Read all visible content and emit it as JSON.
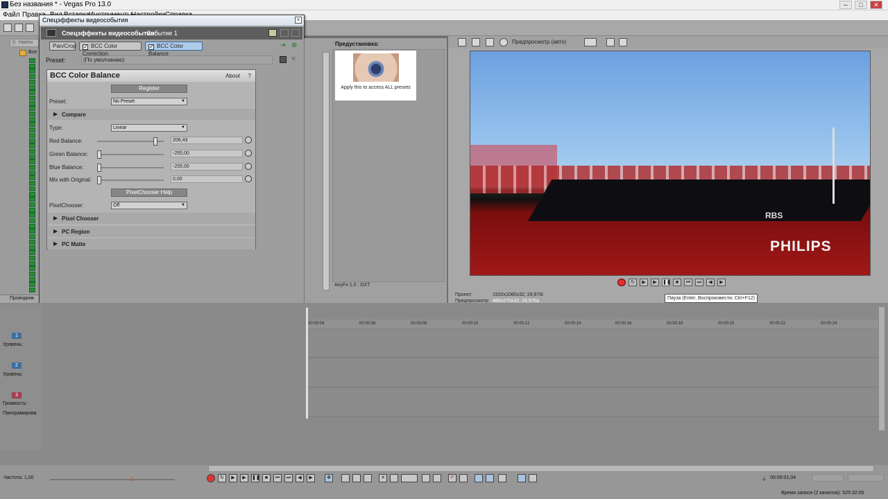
{
  "window": {
    "title": "Без названия * - Vegas Pro 13.0",
    "min": "─",
    "max": "□",
    "close": "✕"
  },
  "menu": [
    "Файл",
    "Правка",
    "Вид",
    "Вставка",
    "Инструменты",
    "Настройки",
    "Справка"
  ],
  "explorer": {
    "search_placeholder": "Найти",
    "item": "Все",
    "tab": "Проводник"
  },
  "fx": {
    "window_title": "Спецэффекты видеособытия",
    "close": "×",
    "header_title": "Спецэффекты видеособытия:",
    "header_event": "Событие 1",
    "chain": [
      "Pan/Crop",
      "BCC Color Correction",
      "BCC Color Balance"
    ],
    "preset_label": "Preset:",
    "preset_value": "(По умолчанию)",
    "plugin": {
      "title": "BCC Color Balance",
      "about": "About",
      "help": "?",
      "register": "Register",
      "preset_label": "Preset:",
      "preset_value": "No Preset",
      "compare": "Compare",
      "type_label": "Type:",
      "type_value": "Linear",
      "params": [
        {
          "label": "Red Balance:",
          "value": "206,43",
          "level": 0.9
        },
        {
          "label": "Green Balance:",
          "value": "-255,00",
          "level": 0.0
        },
        {
          "label": "Blue Balance:",
          "value": "-255,00",
          "level": 0.0
        },
        {
          "label": "Mix with Original:",
          "value": "0,00",
          "level": 0.0
        }
      ],
      "pixelchooser_help": "PixelChooser Help",
      "pixelchooser_label": "PixelChooser:",
      "pixelchooser_value": "Off",
      "sections": [
        "Pixel Chooser",
        "PC Region",
        "PC Matte"
      ]
    }
  },
  "preset_browser": {
    "title": "Предустановка:",
    "card_caption": "Apply this to access ALL presets",
    "footer": "AnyFx 1.0 : DXT"
  },
  "preview": {
    "mode": "Предпросмотр (авто)",
    "watermark": "PHILIPS",
    "sign": "RBS",
    "project_label": "Проект:",
    "project_value": "1920x1080x32; 29,970i",
    "preview_label": "Предпросмотр:",
    "preview_value": "480x270x32; 29,970p",
    "tooltip": "Пауза (Enter, Воспроизвести; Ctrl+F12)"
  },
  "timeline": {
    "ticks": [
      "00:00:04",
      "00:00:06",
      "00:00:08",
      "00:00:10",
      "00:00:12",
      "00:00:14",
      "00:00:16",
      "00:00:18",
      "00:00:20",
      "00:00:22",
      "00:00:24"
    ],
    "tracks": [
      {
        "num": "1",
        "label": "Уровень:",
        "color": "#3f6fa0"
      },
      {
        "num": "2",
        "label": "Уровень:",
        "color": "#3f6fa0"
      },
      {
        "num": "3",
        "label": "Громкость:",
        "label2": "Панорамирова",
        "color": "#a03f4f"
      }
    ]
  },
  "status": {
    "rate": "Частота: 1,00",
    "time": "00:00:01,04",
    "record": "Время записи (2 каналов): 525:32:05"
  }
}
